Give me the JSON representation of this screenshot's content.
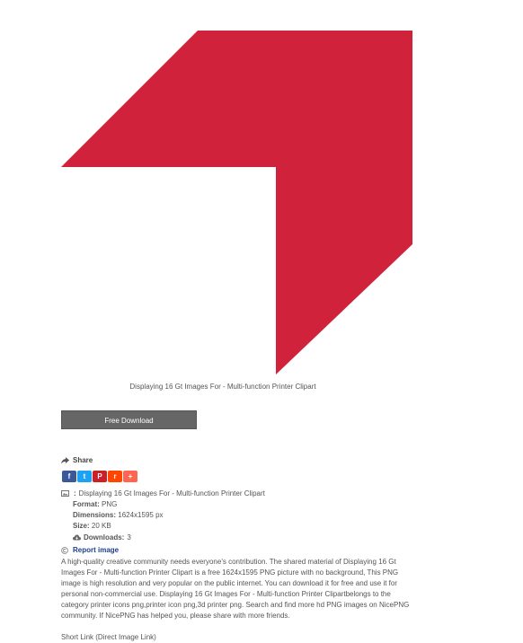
{
  "image": {
    "caption": "Displaying 16 Gt Images For - Multi-function Printer Clipart",
    "fill_color": "#d0223a"
  },
  "download": {
    "label": "Free Download"
  },
  "share": {
    "label": "Share",
    "buttons": [
      {
        "name": "facebook",
        "glyph": "f",
        "color": "#3b5998"
      },
      {
        "name": "twitter",
        "glyph": "t",
        "color": "#1da1f2"
      },
      {
        "name": "pinterest",
        "glyph": "P",
        "color": "#cb2027"
      },
      {
        "name": "reddit",
        "glyph": "r",
        "color": "#ff4500"
      },
      {
        "name": "more",
        "glyph": "+",
        "color": "#ff6550"
      }
    ]
  },
  "meta": {
    "colon": ":",
    "title": "Displaying 16 Gt Images For - Multi-function Printer Clipart",
    "format_label": "Format:",
    "format_value": "PNG",
    "dimensions_label": "Dimensions:",
    "dimensions_value": "1624x1595 px",
    "size_label": "Size:",
    "size_value": "20 KB",
    "downloads_label": "Downloads:",
    "downloads_value": "3"
  },
  "report": {
    "label": "Report image"
  },
  "description": "A high-quality creative community needs everyone's contribution. The shared material of Displaying 16 Gt Images For - Multi-function Printer Clipart is a free 1624x1595 PNG picture with no background, This PNG image is high resolution and very popular on the public internet. You can download it for free and use it for personal non-commercial use. Displaying 16 Gt Images For - Multi-function Printer Clipartbelongs to the category printer icons png,printer icon png,3d printer png. Search and find more hd PNG images on NicePNG community. If NicePNG has helped you, please share with more friends.",
  "short_link": "Short Link (Direct Image Link)"
}
